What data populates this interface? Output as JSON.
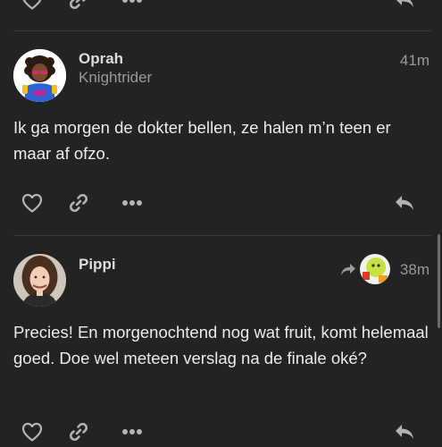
{
  "posts": [
    {
      "display_name": "Oprah",
      "username": "Knightrider",
      "time": "41m",
      "body": "Ik ga morgen de dokter bellen, ze halen m’n teen er maar af ofzo."
    },
    {
      "display_name": "Pippi",
      "username": "",
      "time": "38m",
      "body": "Precies! En morgenochtend nog wat fruit, komt helemaal goed. Doe wel meteen verslag na de finale oké?"
    }
  ],
  "icons": {
    "like": "heart-icon",
    "link": "link-icon",
    "more": "more-icon",
    "reply": "reply-icon",
    "reply_to": "reply-arrow-icon"
  },
  "colors": {
    "background": "#232323",
    "icon": "#b4b4b4",
    "text": "#ececec",
    "muted": "#9a9a9a"
  }
}
